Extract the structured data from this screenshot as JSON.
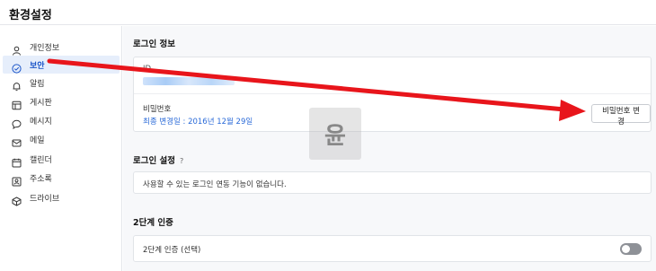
{
  "header": {
    "title": "환경설정"
  },
  "sidebar": {
    "items": [
      {
        "label": "개인정보",
        "icon": "person-icon"
      },
      {
        "label": "보안",
        "icon": "shield-check-icon",
        "active": true
      },
      {
        "label": "알림",
        "icon": "bell-icon"
      },
      {
        "label": "게시판",
        "icon": "board-icon"
      },
      {
        "label": "메시지",
        "icon": "chat-bubble-icon"
      },
      {
        "label": "메일",
        "icon": "mail-icon"
      },
      {
        "label": "캘린더",
        "icon": "calendar-icon"
      },
      {
        "label": "주소록",
        "icon": "contacts-icon"
      },
      {
        "label": "드라이브",
        "icon": "drive-icon"
      }
    ]
  },
  "login_info": {
    "title": "로그인 정보",
    "id_label": "ID",
    "password_label": "비밀번호",
    "last_changed": "최종 변경일 : 2016년 12월 29일",
    "change_password_button": "비밀번호 변경"
  },
  "login_settings": {
    "title": "로그인 설정",
    "help": "?",
    "message": "사용할 수 있는 로그인 연동 기능이 없습니다."
  },
  "two_factor": {
    "title": "2단계 인증",
    "label": "2단계 인증 (선택)",
    "enabled": false
  },
  "watermark": {
    "text": "윤"
  },
  "colors": {
    "accent": "#1c56c9",
    "link": "#2a6ad8",
    "annotation_arrow": "#e8151b"
  }
}
